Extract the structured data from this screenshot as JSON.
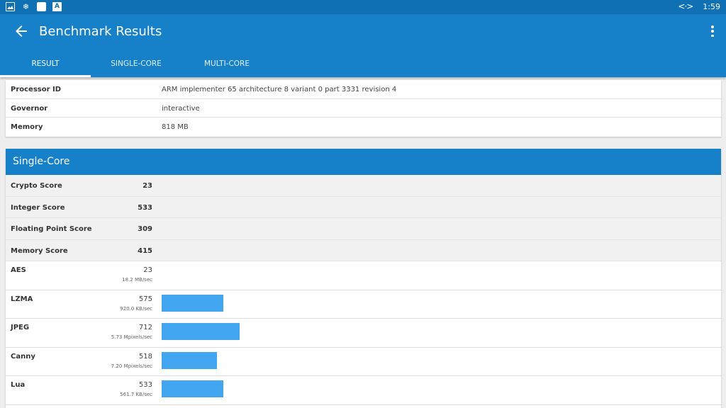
{
  "status_bar": {
    "time": "1:59",
    "icons": [
      "image-icon",
      "snowflake-icon",
      "square-icon",
      "a-icon"
    ],
    "sync_glyph": "<·>"
  },
  "app_bar": {
    "title": "Benchmark Results",
    "back_icon": "arrow-back-icon",
    "menu_icon": "more-vert-icon"
  },
  "tabs": [
    {
      "label": "RESULT",
      "active": true
    },
    {
      "label": "SINGLE-CORE",
      "active": false
    },
    {
      "label": "MULTI-CORE",
      "active": false
    }
  ],
  "system_info": [
    {
      "label": "Processor ID",
      "value": "ARM implementer 65 architecture 8 variant 0 part 3331 revision 4"
    },
    {
      "label": "Governor",
      "value": "interactive"
    },
    {
      "label": "Memory",
      "value": "818 MB"
    }
  ],
  "single_core": {
    "header": "Single-Core",
    "scores": [
      {
        "label": "Crypto Score",
        "value": "23"
      },
      {
        "label": "Integer Score",
        "value": "533"
      },
      {
        "label": "Floating Point Score",
        "value": "309"
      },
      {
        "label": "Memory Score",
        "value": "415"
      }
    ],
    "benchmarks": [
      {
        "label": "AES",
        "score": "23",
        "rate": "18.2 MB/sec",
        "bar_fraction": 0.0
      },
      {
        "label": "LZMA",
        "score": "575",
        "rate": "920.0 KB/sec",
        "bar_fraction": 0.787
      },
      {
        "label": "JPEG",
        "score": "712",
        "rate": "5.73 Mpixels/sec",
        "bar_fraction": 1.0
      },
      {
        "label": "Canny",
        "score": "518",
        "rate": "7.20 Mpixels/sec",
        "bar_fraction": 0.713
      },
      {
        "label": "Lua",
        "score": "533",
        "rate": "561.7 KB/sec",
        "bar_fraction": 0.787
      }
    ]
  },
  "colors": {
    "status_bar": "#0f70b3",
    "primary": "#1681c9",
    "bar": "#42a5f0"
  }
}
